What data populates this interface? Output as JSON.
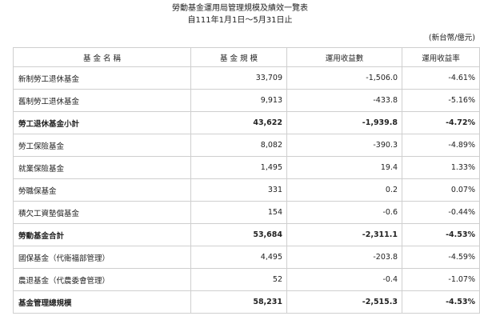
{
  "report": {
    "title": "勞動基金運用局管理規模及績效一覽表",
    "period": "自111年1月1日～5月31日止",
    "unit": "(新台幣/億元)"
  },
  "table": {
    "headers": [
      "基 金 名 稱",
      "基 金 規 模",
      "運用收益數",
      "運用收益率"
    ],
    "rows": [
      {
        "name": "新制勞工退休基金",
        "scale": "33,709",
        "income": "-1,506.0",
        "rate": "-4.61%",
        "bold": false
      },
      {
        "name": "舊制勞工退休基金",
        "scale": "9,913",
        "income": "-433.8",
        "rate": "-5.16%",
        "bold": false
      },
      {
        "name": "勞工退休基金小計",
        "scale": "43,622",
        "income": "-1,939.8",
        "rate": "-4.72%",
        "bold": true
      },
      {
        "name": "勞工保險基金",
        "scale": "8,082",
        "income": "-390.3",
        "rate": "-4.89%",
        "bold": false
      },
      {
        "name": "就業保險基金",
        "scale": "1,495",
        "income": "19.4",
        "rate": "1.33%",
        "bold": false
      },
      {
        "name": "勞職保基金",
        "scale": "331",
        "income": "0.2",
        "rate": "0.07%",
        "bold": false
      },
      {
        "name": "積欠工資墊償基金",
        "scale": "154",
        "income": "-0.6",
        "rate": "-0.44%",
        "bold": false
      },
      {
        "name": "勞動基金合計",
        "scale": "53,684",
        "income": "-2,311.1",
        "rate": "-4.53%",
        "bold": true
      },
      {
        "name": "國保基金（代衛福部管理）",
        "scale": "4,495",
        "income": "-203.8",
        "rate": "-4.59%",
        "bold": false
      },
      {
        "name": "農退基金（代農委會管理）",
        "scale": "52",
        "income": "-0.4",
        "rate": "-1.07%",
        "bold": false
      },
      {
        "name": "基金管理總規模",
        "scale": "58,231",
        "income": "-2,515.3",
        "rate": "-4.53%",
        "bold": true
      }
    ]
  }
}
